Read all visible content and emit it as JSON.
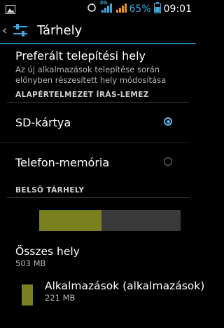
{
  "statusbar": {
    "network_type": "3G",
    "battery_percent": "65%",
    "time": "09:01"
  },
  "actionbar": {
    "title": "Tárhely"
  },
  "preferred": {
    "title": "Preferált telepítési hely",
    "summary": "Az új alkalmazások telepítése során előnyben részesített hely módosítása"
  },
  "section_default": {
    "header": "ALAPÉRTELMEZET ÍRÁS-LEMEZ"
  },
  "options": [
    {
      "label": "SD-kártya",
      "selected": true
    },
    {
      "label": "Telefon-memória",
      "selected": false
    }
  ],
  "section_internal": {
    "header": "BELSŐ TÁRHELY"
  },
  "storage_bar": {
    "used_fraction": 0.44,
    "used_color": "#7a7f1f",
    "free_color": "#3a3a3a"
  },
  "total": {
    "title": "Összes hely",
    "value": "503 MB"
  },
  "apps": {
    "title": "Alkalmazások (alkalmazások)",
    "value": "221 MB",
    "color": "#7a7f1f"
  }
}
